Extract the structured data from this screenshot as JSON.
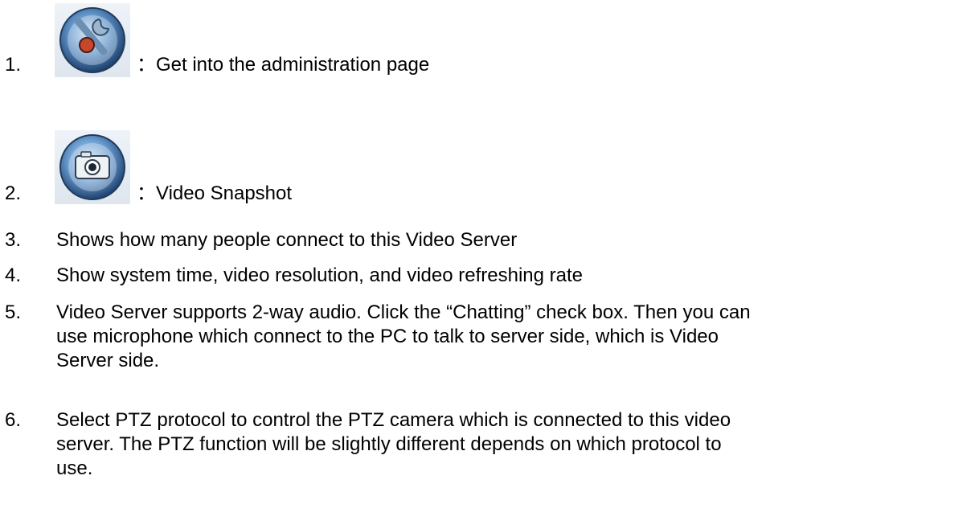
{
  "items": [
    {
      "number": "1.",
      "icon": "wrench-tools-icon",
      "separator": "：",
      "text": "Get into the administration page"
    },
    {
      "number": "2.",
      "icon": "camera-snapshot-icon",
      "separator": "：",
      "text": "Video Snapshot"
    },
    {
      "number": "3.",
      "text": "Shows how many people connect to this Video Server"
    },
    {
      "number": "4.",
      "text": "Show system time, video resolution, and video refreshing rate"
    },
    {
      "number": "5.",
      "lines": [
        "Video Server supports 2-way audio. Click the “Chatting” check box. Then you can",
        "use microphone which connect to the PC to talk to server side, which is Video",
        "Server side."
      ]
    },
    {
      "number": "6.",
      "lines": [
        "Select PTZ protocol to control the PTZ camera which is connected to this video",
        "server. The PTZ function will be slightly different depends on which protocol to",
        "use."
      ]
    }
  ]
}
